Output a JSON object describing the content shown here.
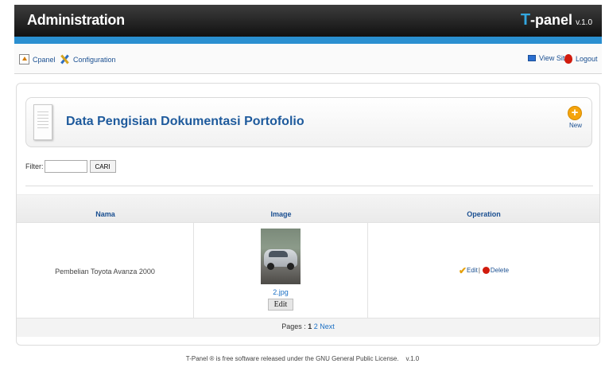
{
  "header": {
    "title": "Administration",
    "brand_t": "T",
    "brand_rest": "-panel",
    "version": "v.1.0",
    "accent_color": "#2a8fd0"
  },
  "toolbar": {
    "cpanel_label": "Cpanel",
    "configuration_label": "Configuration",
    "view_site_label": "View Site",
    "logout_label": "Logout"
  },
  "page": {
    "title": "Data Pengisian Dokumentasi Portofolio",
    "new_label": "New"
  },
  "filter": {
    "label": "Filter:",
    "value": "",
    "search_button": "CARI"
  },
  "table": {
    "columns": [
      "Nama",
      "Image",
      "Operation"
    ],
    "rows": [
      {
        "nama": "Pembelian Toyota Avanza 2000",
        "image_file": "2.jpg",
        "image_edit": "Edit",
        "op_edit": "Edit",
        "op_delete": "Delete"
      }
    ]
  },
  "pagination": {
    "label": "Pages :",
    "current": "1",
    "next_page": "2",
    "next_label": "Next"
  },
  "footer": {
    "text": "T-Panel ® is free software released under the GNU General Public License.",
    "version": "v.1.0"
  }
}
